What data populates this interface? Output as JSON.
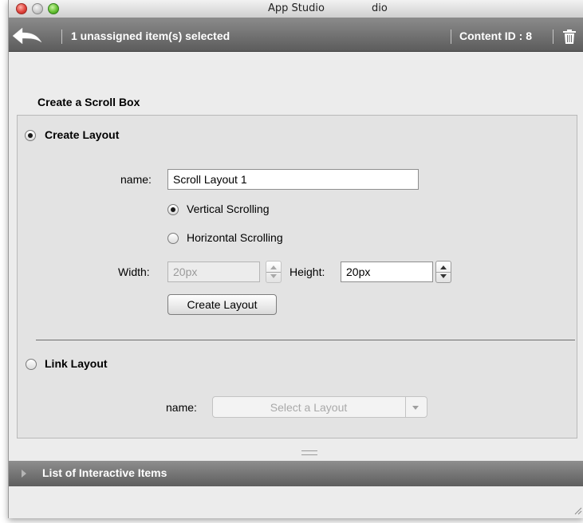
{
  "window": {
    "title": "App Studio",
    "title_extra": "dio"
  },
  "toolbar": {
    "selection_status": "1 unassigned item(s) selected",
    "content_id": "Content ID : 8"
  },
  "form": {
    "heading": "Create a Scroll Box",
    "create_layout": {
      "option_label": "Create Layout",
      "selected": true,
      "name_label": "name:",
      "name_value": "Scroll Layout 1",
      "vertical_label": "Vertical Scrolling",
      "vertical_selected": true,
      "horizontal_label": "Horizontal Scrolling",
      "horizontal_selected": false,
      "width_label": "Width:",
      "width_value": "20px",
      "width_disabled": true,
      "height_label": "Height:",
      "height_value": "20px",
      "button_label": "Create Layout"
    },
    "link_layout": {
      "option_label": "Link Layout",
      "selected": false,
      "name_label": "name:",
      "select_placeholder": "Select a Layout"
    }
  },
  "interactive_items": {
    "label": "List of Interactive Items",
    "expanded": false
  }
}
